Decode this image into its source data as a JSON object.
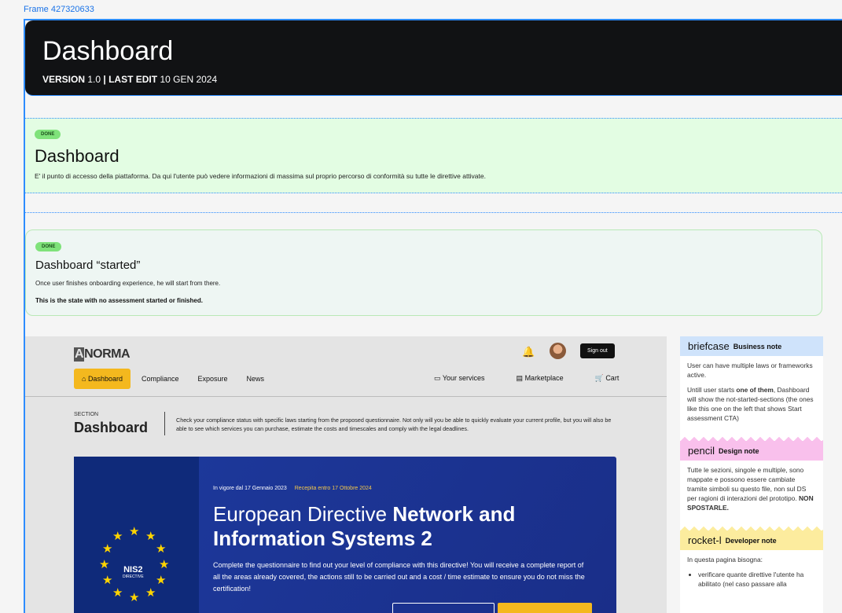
{
  "frame_label": "Frame 427320633",
  "header": {
    "title": "Dashboard",
    "version_label": "VERSION",
    "version": "1.0",
    "sep": "|",
    "last_edit_label": "LAST EDIT",
    "last_edit": "10 GEN 2024"
  },
  "section1": {
    "badge": "DONE",
    "title": "Dashboard",
    "text": "E' il punto di accesso della piattaforma. Da qui l'utente può vedere informazioni di massima sul proprio percorso di conformità su tutte le direttive attivate."
  },
  "section2": {
    "badge": "DONE",
    "title": "Dashboard “started”",
    "text1": "Once user finishes onboarding experience, he will start from there.",
    "text2": "This is the state with no assessment started or finished."
  },
  "app": {
    "logo_a": "A",
    "logo_rest": "NORMA",
    "sign_out": "Sign out",
    "nav": [
      "Dashboard",
      "Compliance",
      "Exposure",
      "News"
    ],
    "right_nav": [
      "Your services",
      "Marketplace",
      "Cart"
    ],
    "section_label": "SECTION",
    "section_title": "Dashboard",
    "section_desc": "Check your compliance status with specific laws starting from the proposed questionnaire. Not only will you be able to quickly evaluate your current profile, but you will also be able to see which services you can purchase, estimate the costs and timescales and comply with the legal deadlines.",
    "card": {
      "date1": "In vigore dal 17 Gennaio 2023",
      "date2": "Recepita entro 17 Ottobre 2024",
      "title_light": "European Directive ",
      "title_bold": "Network and Information Systems 2",
      "desc": "Complete the questionnaire to find out your level of compliance with this directive!  You will receive a complete report of all the areas already covered, the actions still to be carried out and a cost / time estimate to ensure you do not miss the certification!",
      "emblem_title": "NIS2",
      "emblem_sub": "DIRECTIVE"
    }
  },
  "notes": {
    "business": {
      "icon_text": "briefcase",
      "title": "Business note",
      "p1": "User can have multiple laws or frameworks active.",
      "p2_a": "Untill user starts ",
      "p2_b": "one of them",
      "p2_c": ", Dashboard will show the not-started-sections (the ones like this one on the left that shows Start assessment CTA)"
    },
    "design": {
      "icon_text": "pencil",
      "title": "Design note",
      "p1": "Tutte le sezioni, singole e multiple, sono mappate e possono essere cambiate tramite simboli su questo file, non sul DS per ragioni di interazioni del prototipo. ",
      "p1_bold": "NON SPOSTARLE."
    },
    "developer": {
      "icon_text": "rocket-l",
      "title": "Developer note",
      "p1": "In questa pagina bisogna:",
      "li1": "verificare quante direttive l'utente ha abilitato (nel caso passare alla"
    }
  },
  "colors": {
    "accent": "#f4b81e",
    "header_bg": "#111214",
    "done_badge": "#7fe27a",
    "card_blue": "#1d3a9e"
  }
}
